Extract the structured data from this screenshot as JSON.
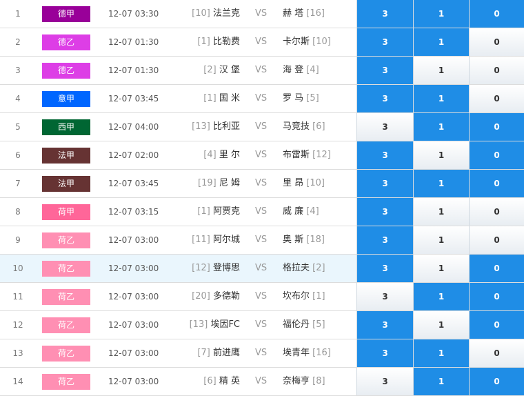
{
  "vs_label": "VS",
  "option_labels": [
    "3",
    "1",
    "0"
  ],
  "league_colors": {
    "德甲": "#990099",
    "德乙": "#dd3ee6",
    "意甲": "#0066ff",
    "西甲": "#006633",
    "法甲": "#663333",
    "荷甲": "#ff6699",
    "荷乙": "#ff8fb3"
  },
  "matches": [
    {
      "num": "1",
      "league": "德甲",
      "time": "12-07 03:30",
      "home_rank": "[10]",
      "home": "法兰克",
      "away": "赫 塔",
      "away_rank": "[16]",
      "selected": [
        true,
        true,
        true
      ],
      "highlight": false
    },
    {
      "num": "2",
      "league": "德乙",
      "time": "12-07 01:30",
      "home_rank": "[1]",
      "home": "比勒费",
      "away": "卡尔斯",
      "away_rank": "[10]",
      "selected": [
        true,
        true,
        false
      ],
      "highlight": false
    },
    {
      "num": "3",
      "league": "德乙",
      "time": "12-07 01:30",
      "home_rank": "[2]",
      "home": "汉 堡",
      "away": "海 登",
      "away_rank": "[4]",
      "selected": [
        true,
        false,
        false
      ],
      "highlight": false
    },
    {
      "num": "4",
      "league": "意甲",
      "time": "12-07 03:45",
      "home_rank": "[1]",
      "home": "国 米",
      "away": "罗 马",
      "away_rank": "[5]",
      "selected": [
        true,
        true,
        false
      ],
      "highlight": false
    },
    {
      "num": "5",
      "league": "西甲",
      "time": "12-07 04:00",
      "home_rank": "[13]",
      "home": "比利亚",
      "away": "马竞技",
      "away_rank": "[6]",
      "selected": [
        false,
        true,
        true
      ],
      "highlight": false
    },
    {
      "num": "6",
      "league": "法甲",
      "time": "12-07 02:00",
      "home_rank": "[4]",
      "home": "里 尔",
      "away": "布雷斯",
      "away_rank": "[12]",
      "selected": [
        true,
        false,
        true
      ],
      "highlight": false
    },
    {
      "num": "7",
      "league": "法甲",
      "time": "12-07 03:45",
      "home_rank": "[19]",
      "home": "尼 姆",
      "away": "里 昂",
      "away_rank": "[10]",
      "selected": [
        true,
        true,
        true
      ],
      "highlight": false
    },
    {
      "num": "8",
      "league": "荷甲",
      "time": "12-07 03:15",
      "home_rank": "[1]",
      "home": "阿贾克",
      "away": "威 廉",
      "away_rank": "[4]",
      "selected": [
        true,
        false,
        false
      ],
      "highlight": false
    },
    {
      "num": "9",
      "league": "荷乙",
      "time": "12-07 03:00",
      "home_rank": "[11]",
      "home": "阿尔城",
      "away": "奥 斯",
      "away_rank": "[18]",
      "selected": [
        true,
        false,
        false
      ],
      "highlight": false
    },
    {
      "num": "10",
      "league": "荷乙",
      "time": "12-07 03:00",
      "home_rank": "[12]",
      "home": "登博思",
      "away": "格拉夫",
      "away_rank": "[2]",
      "selected": [
        true,
        false,
        true
      ],
      "highlight": true
    },
    {
      "num": "11",
      "league": "荷乙",
      "time": "12-07 03:00",
      "home_rank": "[20]",
      "home": "多德勒",
      "away": "坎布尔",
      "away_rank": "[1]",
      "selected": [
        false,
        true,
        true
      ],
      "highlight": false
    },
    {
      "num": "12",
      "league": "荷乙",
      "time": "12-07 03:00",
      "home_rank": "[13]",
      "home": "埃因FC",
      "away": "福伦丹",
      "away_rank": "[5]",
      "selected": [
        true,
        false,
        true
      ],
      "highlight": false
    },
    {
      "num": "13",
      "league": "荷乙",
      "time": "12-07 03:00",
      "home_rank": "[7]",
      "home": "前进鹰",
      "away": "埃青年",
      "away_rank": "[16]",
      "selected": [
        true,
        true,
        false
      ],
      "highlight": false
    },
    {
      "num": "14",
      "league": "荷乙",
      "time": "12-07 03:00",
      "home_rank": "[6]",
      "home": "精 英",
      "away": "奈梅亨",
      "away_rank": "[8]",
      "selected": [
        false,
        true,
        true
      ],
      "highlight": false
    }
  ]
}
